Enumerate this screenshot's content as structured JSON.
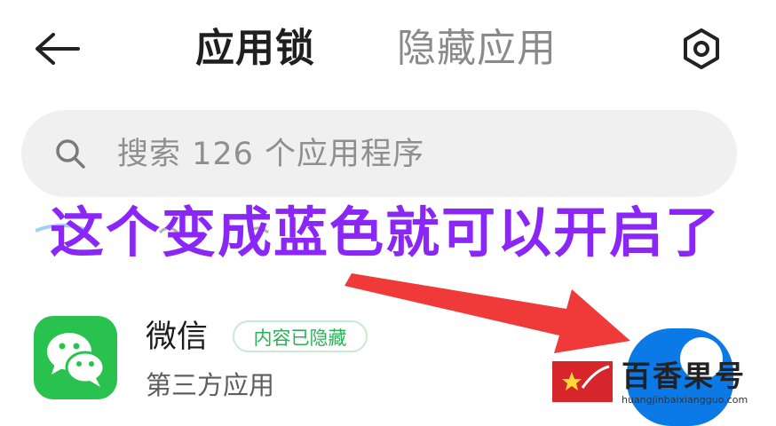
{
  "header": {
    "tab_app_lock": "应用锁",
    "tab_hidden_apps": "隐藏应用",
    "icons": {
      "back": "back-arrow-icon",
      "settings": "settings-hexagon-icon"
    }
  },
  "search": {
    "placeholder": "搜索 126 个应用程序",
    "icon": "search-icon"
  },
  "annotation": {
    "caption": "这个变成蓝色就可以开启了",
    "caption_color": "#8a27f6",
    "arrow_color": "#f03a3a"
  },
  "app_list": [
    {
      "name": "微信",
      "badge": "内容已隐藏",
      "subtitle": "第三方应用",
      "toggle_on": true,
      "toggle_color": "#0b79e6",
      "icon": "wechat-icon"
    }
  ],
  "watermark": {
    "name": "百香果号",
    "url": "huangjinbaixiangguo.com"
  }
}
